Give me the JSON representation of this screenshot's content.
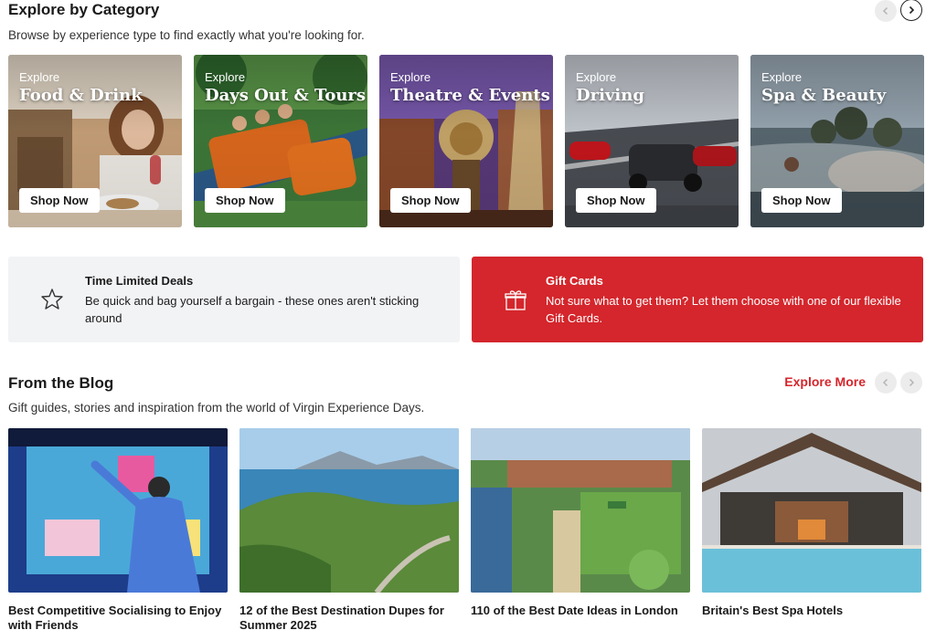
{
  "category_section": {
    "title": "Explore by Category",
    "subtitle": "Browse by experience type to find exactly what you're looking for.",
    "nav": {
      "prev_icon": "chevron-left-icon",
      "next_icon": "chevron-right-icon"
    },
    "cards": [
      {
        "explore": "Explore",
        "name": "Food & Drink",
        "button": "Shop Now"
      },
      {
        "explore": "Explore",
        "name": "Days Out & Tours",
        "button": "Shop Now"
      },
      {
        "explore": "Explore",
        "name": "Theatre & Events",
        "button": "Shop Now"
      },
      {
        "explore": "Explore",
        "name": "Driving",
        "button": "Shop Now"
      },
      {
        "explore": "Explore",
        "name": "Spa & Beauty",
        "button": "Shop Now"
      }
    ]
  },
  "promos": {
    "deals": {
      "icon": "star-icon",
      "title": "Time Limited Deals",
      "description": "Be quick and bag yourself a bargain - these ones aren't sticking around"
    },
    "gift": {
      "icon": "gift-icon",
      "title": "Gift Cards",
      "description": "Not sure what to get them? Let them choose with one of our flexible Gift Cards."
    }
  },
  "blog_section": {
    "title": "From the Blog",
    "subtitle": "Gift guides, stories and inspiration from the world of Virgin Experience Days.",
    "explore_more": "Explore More",
    "posts": [
      {
        "title": "Best Competitive Socialising to Enjoy with Friends"
      },
      {
        "title": "12 of the Best Destination Dupes for Summer 2025"
      },
      {
        "title": "110 of the Best Date Ideas in London"
      },
      {
        "title": "Britain's Best Spa Hotels"
      }
    ]
  },
  "colors": {
    "accent": "#d4262c",
    "promo_gray": "#f2f3f5"
  }
}
